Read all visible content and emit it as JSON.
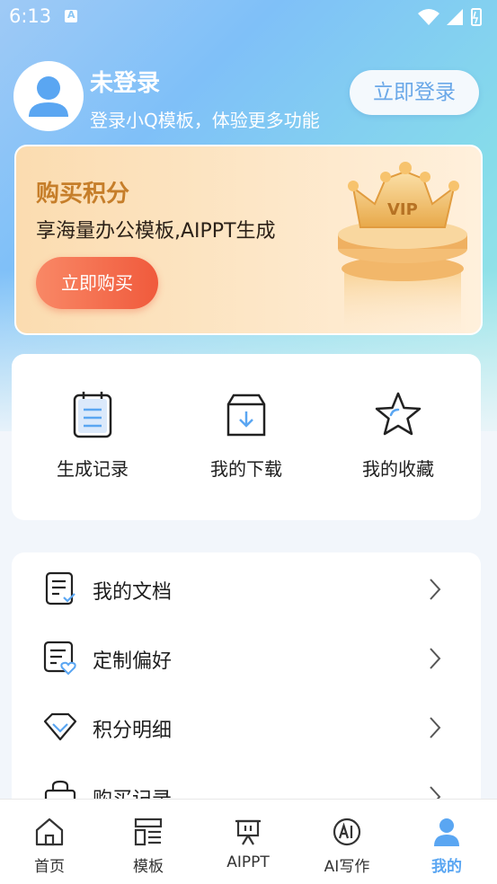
{
  "status_bar": {
    "time": "6:13"
  },
  "profile": {
    "name": "未登录",
    "subtitle": "登录小Q模板，体验更多功能",
    "login_button": "立即登录"
  },
  "vip_card": {
    "title": "购买积分",
    "subtitle": "享海量办公模板,AIPPT生成",
    "buy_button": "立即购买",
    "badge_text": "VIP"
  },
  "quick_actions": [
    {
      "label": "生成记录",
      "icon": "clipboard-icon"
    },
    {
      "label": "我的下载",
      "icon": "download-box-icon"
    },
    {
      "label": "我的收藏",
      "icon": "star-icon"
    }
  ],
  "menu_items": [
    {
      "label": "我的文档",
      "icon": "document-check-icon"
    },
    {
      "label": "定制偏好",
      "icon": "document-heart-icon"
    },
    {
      "label": "积分明细",
      "icon": "diamond-icon"
    },
    {
      "label": "购买记录",
      "icon": "shopping-bag-icon"
    }
  ],
  "tabs": [
    {
      "label": "首页",
      "icon": "home-icon"
    },
    {
      "label": "模板",
      "icon": "template-icon"
    },
    {
      "label": "AIPPT",
      "icon": "presentation-icon"
    },
    {
      "label": "AI写作",
      "icon": "ai-icon"
    },
    {
      "label": "我的",
      "icon": "user-icon",
      "active": true
    }
  ],
  "colors": {
    "accent": "#5aa6f2",
    "vip_title": "#c67e2a",
    "buy_button": "#f05a3c"
  }
}
